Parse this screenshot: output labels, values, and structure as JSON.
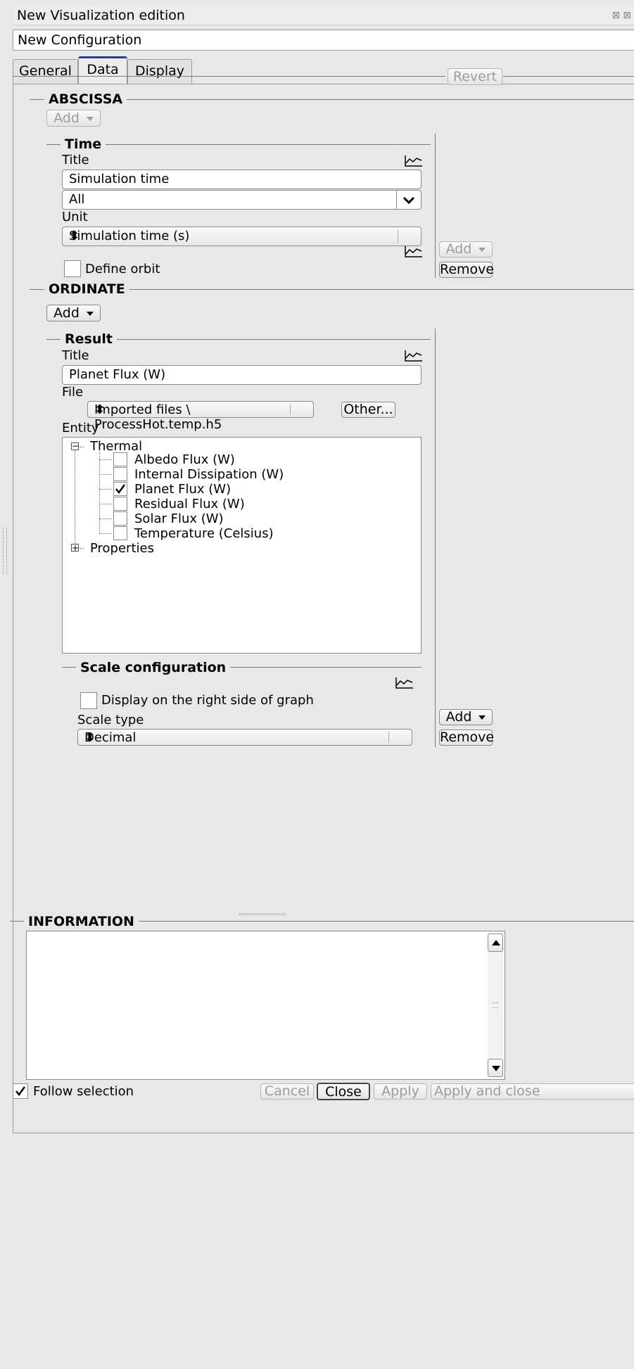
{
  "window": {
    "title": "New Visualization edition",
    "configuration_name": "New Configuration"
  },
  "tabs": [
    {
      "label": "General"
    },
    {
      "label": "Data"
    },
    {
      "label": "Display"
    }
  ],
  "toolbar": {
    "revert_label": "Revert"
  },
  "abscissa": {
    "section_title": "ABSCISSA",
    "add_label": "Add",
    "time": {
      "section_title": "Time",
      "title_label": "Title",
      "title_value": "Simulation time",
      "filter_value": "All",
      "unit_label": "Unit",
      "unit_value": "Simulation time (s)",
      "define_orbit_label": "Define orbit",
      "define_orbit_checked": false,
      "add_label": "Add",
      "remove_label": "Remove"
    }
  },
  "ordinate": {
    "section_title": "ORDINATE",
    "add_label": "Add",
    "result": {
      "section_title": "Result",
      "title_label": "Title",
      "title_value": "Planet Flux (W)",
      "file_label": "File",
      "file_value": "Imported files \\ ProcessHot.temp.h5",
      "other_label": "Other...",
      "entity_label": "Entity",
      "tree": {
        "group": "Thermal",
        "items": [
          {
            "label": "Albedo Flux (W)",
            "checked": false
          },
          {
            "label": "Internal Dissipation (W)",
            "checked": false
          },
          {
            "label": "Planet Flux (W)",
            "checked": true
          },
          {
            "label": "Residual Flux (W)",
            "checked": false
          },
          {
            "label": "Solar Flux (W)",
            "checked": false
          },
          {
            "label": "Temperature (Celsius)",
            "checked": false
          }
        ],
        "collapsed_group": "Properties"
      },
      "scale": {
        "section_title": "Scale configuration",
        "right_side_label": "Display on the right side of graph",
        "right_side_checked": false,
        "scale_type_label": "Scale type",
        "scale_type_value": "Decimal"
      },
      "add_label": "Add",
      "remove_label": "Remove"
    }
  },
  "information": {
    "section_title": "INFORMATION",
    "content": ""
  },
  "footer": {
    "follow_selection_label": "Follow selection",
    "follow_selection_checked": true,
    "cancel_label": "Cancel",
    "close_label": "Close",
    "apply_label": "Apply",
    "apply_close_label": "Apply and close"
  },
  "colors": {
    "active_tab_accent": "#2b3d8f",
    "background": "#e8e8e8"
  }
}
